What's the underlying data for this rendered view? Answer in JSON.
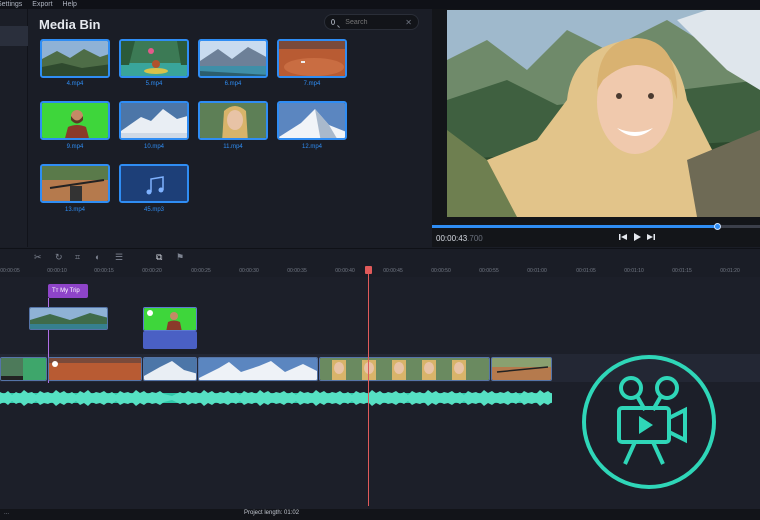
{
  "menu": {
    "items": [
      "Settings",
      "Export",
      "Help"
    ]
  },
  "media_bin": {
    "title": "Media Bin",
    "search_placeholder": "Search",
    "items": [
      {
        "label": "4.mp4",
        "kind": "mountain-valley"
      },
      {
        "label": "5.mp4",
        "kind": "kayak"
      },
      {
        "label": "6.mp4",
        "kind": "lake"
      },
      {
        "label": "7.mp4",
        "kind": "desert"
      },
      {
        "label": "9.mp4",
        "kind": "greenscreen"
      },
      {
        "label": "10.mp4",
        "kind": "snow-peak"
      },
      {
        "label": "11.mp4",
        "kind": "selfie"
      },
      {
        "label": "12.mp4",
        "kind": "snow-peak"
      },
      {
        "label": "13.mp4",
        "kind": "bike"
      },
      {
        "label": "45.mp3",
        "kind": "audio"
      }
    ]
  },
  "preview": {
    "timecode": "00:00:43",
    "timecode_ms": ".700",
    "progress": 0.87
  },
  "ruler": [
    "00:00:05",
    "00:00:10",
    "00:00:15",
    "00:00:20",
    "00:00:25",
    "00:00:30",
    "00:00:35",
    "00:00:40",
    "00:00:45",
    "00:00:50",
    "00:00:55",
    "00:01:00",
    "00:01:05",
    "00:01:10",
    "00:01:15",
    "00:01:20"
  ],
  "timeline": {
    "title_clip": "My Trip"
  },
  "status": {
    "left": "...",
    "project_length": "Project length:  01:02"
  },
  "colors": {
    "accent": "#2f8df4",
    "title_clip": "#8e44c8",
    "audio": "#2fc6a8",
    "playhead": "#e05a5a",
    "logo": "#2fd6b8"
  },
  "icons": {
    "toolbar": [
      "cut-icon",
      "redo-icon",
      "crop-icon",
      "color-icon",
      "properties-icon",
      "overlay-icon",
      "marker-icon"
    ],
    "controls": [
      "skip-back-icon",
      "play-icon",
      "skip-forward-icon"
    ]
  }
}
